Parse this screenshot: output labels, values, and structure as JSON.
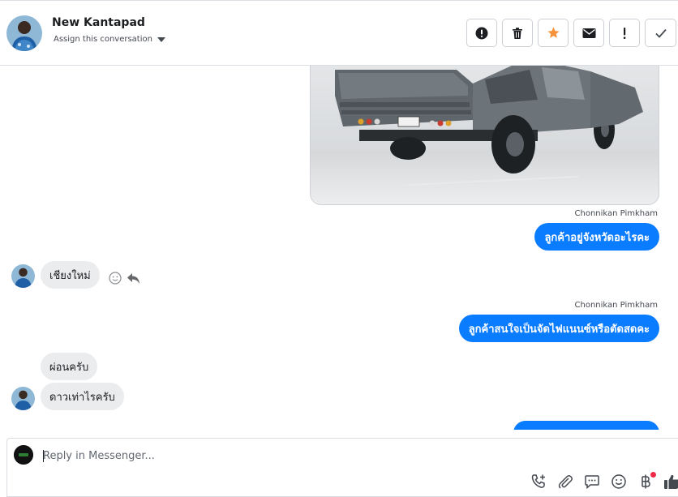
{
  "header": {
    "contact_name": "New Kantapad",
    "assign_label": "Assign this conversation",
    "actions": [
      {
        "name": "mark-spam-button",
        "icon": "exclamation-circle-icon"
      },
      {
        "name": "delete-button",
        "icon": "trash-icon"
      },
      {
        "name": "star-button",
        "icon": "star-icon",
        "color": "#f7923b"
      },
      {
        "name": "mark-unread-button",
        "icon": "envelope-icon"
      },
      {
        "name": "follow-up-button",
        "icon": "exclamation-icon"
      },
      {
        "name": "mark-done-button",
        "icon": "check-icon"
      }
    ]
  },
  "messages": [
    {
      "type": "image",
      "direction": "outgoing",
      "description_icon": "pickup-truck-photo"
    },
    {
      "type": "sender",
      "text": "Chonnikan Pimkham"
    },
    {
      "type": "text",
      "direction": "outgoing",
      "text": "ลูกค้าอยู่จังหวัดอะไรคะ"
    },
    {
      "type": "text",
      "direction": "incoming",
      "text": "เชียงใหม่"
    },
    {
      "type": "sender",
      "text": "Chonnikan Pimkham"
    },
    {
      "type": "text",
      "direction": "outgoing",
      "text": "ลูกค้าสนใจเป็นจัดไฟแนนซ์หรือตัดสดคะ"
    },
    {
      "type": "text",
      "direction": "incoming",
      "text": "ผ่อนครับ"
    },
    {
      "type": "text",
      "direction": "incoming",
      "text": "ดาวเท่าไรครับ"
    }
  ],
  "composer": {
    "placeholder": "Reply in Messenger...",
    "tools": [
      "phone-add-icon",
      "paperclip-icon",
      "saved-reply-icon",
      "emoji-icon",
      "baht-payment-icon",
      "thumbs-up-icon"
    ]
  },
  "colors": {
    "outgoing_bubble": "#0a7cff",
    "incoming_bubble": "#ebecee",
    "star": "#f7923b",
    "notification_dot": "#f02849"
  }
}
